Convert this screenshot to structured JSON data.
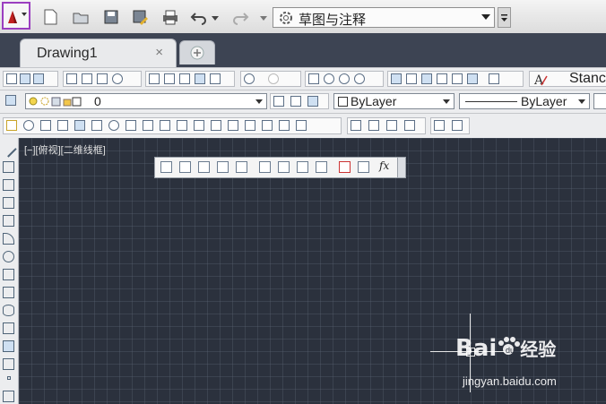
{
  "workspace": {
    "label": "草图与注释"
  },
  "tabs": {
    "drawing": "Drawing1",
    "close": "×"
  },
  "toolbar": {
    "text_style": "Stanc",
    "layer": "0",
    "color": "ByLayer",
    "linetype": "ByLayer"
  },
  "viewport": {
    "label": "[−][俯视][二维线框]"
  },
  "floating": {
    "fx": "fx"
  },
  "watermark": {
    "brand": "Bai",
    "brand2": "经验",
    "url": "jingyan.baidu.com"
  }
}
